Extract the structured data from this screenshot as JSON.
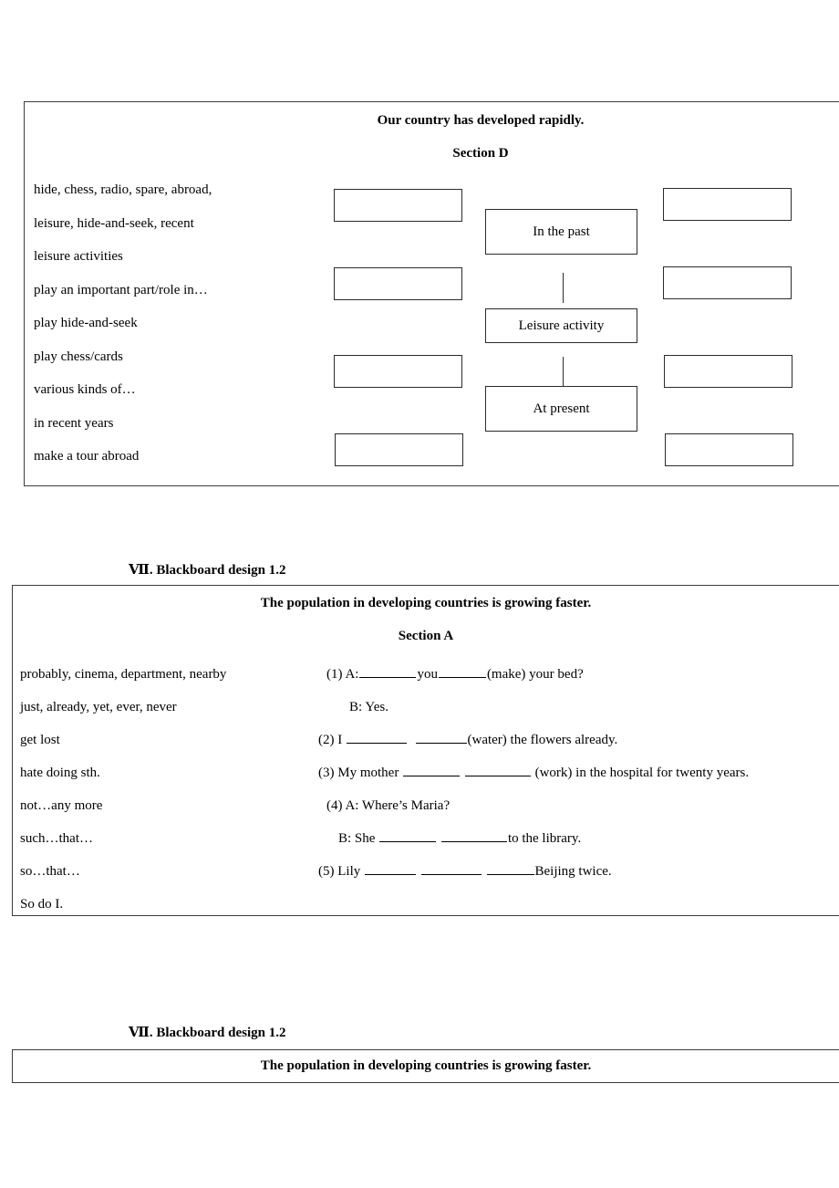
{
  "section_d": {
    "title": "Our country has developed rapidly.",
    "subtitle": "Section D",
    "word_list": [
      "hide, chess, radio, spare, abroad,",
      "leisure, hide-and-seek, recent",
      "leisure activities",
      "play an important part/role in…",
      "play hide-and-seek",
      "play chess/cards",
      "various kinds of…",
      "in recent years",
      "make a tour abroad"
    ],
    "diagram": {
      "center_boxes": [
        {
          "label": "In the past"
        },
        {
          "label": "Leisure activity"
        },
        {
          "label": "At present"
        }
      ],
      "left_blank_boxes": [
        "",
        "",
        "",
        ""
      ],
      "right_blank_boxes": [
        "",
        "",
        "",
        ""
      ]
    }
  },
  "design_heading_a": "Ⅶ. Blackboard design 1.2",
  "design_heading_b": "Ⅶ. Blackboard design 1.2",
  "section_a": {
    "title": "The population in developing countries is growing faster.",
    "subtitle": "Section A",
    "word_list": [
      "probably, cinema, department, nearby",
      "just, already, yet, ever, never",
      "get lost",
      "hate doing sth.",
      "not…any more",
      "such…that…",
      "so…that…",
      "So do I."
    ],
    "exercises": [
      {
        "number": "(1)",
        "pre": "A:",
        "mid": "you",
        "post": "(make) your bed?"
      },
      {
        "answer_line": "B: Yes."
      },
      {
        "number": "(2)",
        "pre": "I",
        "post": "(water) the flowers already."
      },
      {
        "number": "(3)",
        "pre": "My mother",
        "post": "(work) in the hospital for twenty years."
      },
      {
        "number": "(4)",
        "pre": "A: Where’s Maria?"
      },
      {
        "answer_line": "B: She",
        "post": "to the library."
      },
      {
        "number": "(5)",
        "pre": "Lily",
        "post": "Beijing twice."
      }
    ]
  },
  "section_b": {
    "title": "The population in developing countries is growing faster."
  }
}
